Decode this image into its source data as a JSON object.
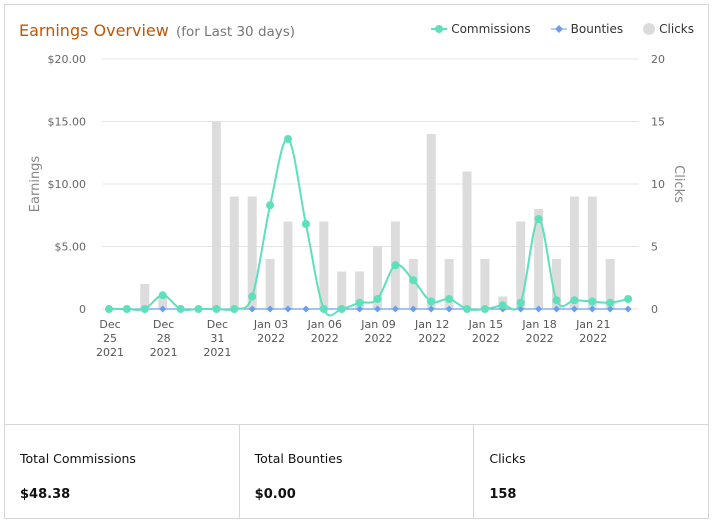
{
  "header": {
    "title": "Earnings Overview",
    "subtitle": "(for Last 30 days)"
  },
  "legend": [
    {
      "label": "Commissions",
      "color": "#5fe0bc",
      "marker": "line-dot"
    },
    {
      "label": "Bounties",
      "color": "#6d9eeb",
      "marker": "diamond"
    },
    {
      "label": "Clicks",
      "color": "#dcdcdc",
      "marker": "circle"
    }
  ],
  "chart_data": {
    "type": "bar",
    "ylabel": "Earnings",
    "y2label": "Clicks",
    "ylim": [
      0,
      20
    ],
    "y2lim": [
      0,
      20
    ],
    "yticks": [
      "0",
      "$5.00",
      "$10.00",
      "$15.00",
      "$20.00"
    ],
    "y2ticks": [
      "0",
      "5",
      "10",
      "15",
      "20"
    ],
    "grid": true,
    "legend_position": "top-right",
    "x_tick_labels": [
      [
        "Dec",
        "25",
        "2021"
      ],
      [
        "Dec",
        "28",
        "2021"
      ],
      [
        "Dec",
        "31",
        "2021"
      ],
      [
        "Jan 03",
        "2022"
      ],
      [
        "Jan 06",
        "2022"
      ],
      [
        "Jan 09",
        "2022"
      ],
      [
        "Jan 12",
        "2022"
      ],
      [
        "Jan 15",
        "2022"
      ],
      [
        "Jan 18",
        "2022"
      ],
      [
        "Jan 21",
        "2022"
      ]
    ],
    "series": [
      {
        "name": "Clicks",
        "kind": "bar",
        "axis": "right",
        "values": [
          0,
          0,
          2,
          1,
          0,
          0,
          15,
          9,
          9,
          4,
          7,
          0,
          7,
          3,
          3,
          5,
          7,
          4,
          14,
          4,
          11,
          4,
          1,
          7,
          8,
          4,
          9,
          9,
          4
        ]
      },
      {
        "name": "Commissions",
        "kind": "line",
        "axis": "left",
        "values": [
          0,
          0,
          0,
          1.1,
          0,
          0,
          0,
          0,
          1.0,
          8.3,
          13.6,
          6.8,
          0,
          0,
          0.5,
          0.8,
          3.5,
          2.3,
          0.6,
          0.8,
          0,
          0,
          0.3,
          0.5,
          7.2,
          0.7,
          0.7,
          0.6,
          0.5,
          0.8
        ]
      },
      {
        "name": "Bounties",
        "kind": "line",
        "axis": "left",
        "values": [
          0,
          0,
          0,
          0,
          0,
          0,
          0,
          0,
          0,
          0,
          0,
          0,
          0,
          0,
          0,
          0,
          0,
          0,
          0,
          0,
          0,
          0,
          0,
          0,
          0,
          0,
          0,
          0,
          0,
          0
        ]
      }
    ]
  },
  "summary": [
    {
      "label": "Total Commissions",
      "value": "$48.38"
    },
    {
      "label": "Total Bounties",
      "value": "$0.00"
    },
    {
      "label": "Clicks",
      "value": "158"
    }
  ]
}
